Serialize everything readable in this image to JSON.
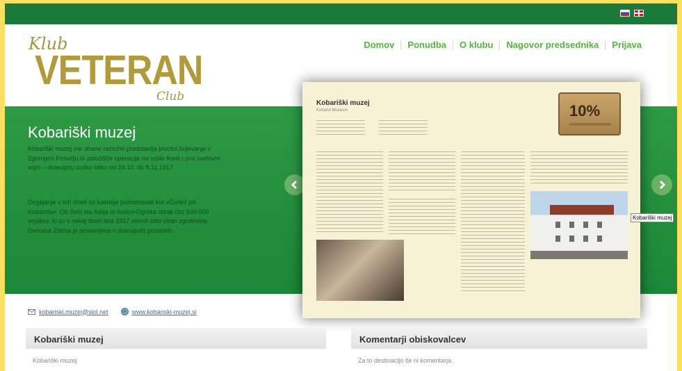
{
  "header": {
    "flags": [
      "slovenian-flag-icon",
      "english-flag-icon"
    ]
  },
  "logo": {
    "top": "Klub",
    "main": "VETERAN",
    "bottom": "Club"
  },
  "nav": {
    "items": [
      "Domov",
      "Ponudba",
      "O klubu",
      "Nagovor predsednika",
      "Prijava"
    ]
  },
  "hero": {
    "title": "Kobariški muzej",
    "paragraph1": "Kobariški muzej me ahane razložel predstavlja prvotni bojevanje v Zgornjem Posočju in zatočišče operacije na soški fronti i prvi svetovni vojni – dvanajstu soško bitko od 24.10. do 8.11.1917.",
    "paragraph2": "Dogajanje v teh dneh so kasneje poimenovali kot »Čudež pri Kobaridu«. Ob Soči sta Italija in Avstro-Ogrska zbrali čez 500 000 vojakov, ki so v nekaj dneh leta 1917 obrnili celo stran zgodovine. Dvorana Zbirna je postavljena v dvanajstih prostorih."
  },
  "card": {
    "title": "Kobariški muzej",
    "subtitle": "Kobarid Museum",
    "badge": "10%"
  },
  "tooltip": "Kobariški muzej",
  "links": {
    "email": "kobariski.muzej@siol.net",
    "web": "www.kobariski-muzej.si"
  },
  "panels": {
    "left": {
      "title": "Kobariški muzej",
      "body": "Kobariški muzej"
    },
    "right": {
      "title": "Komentarji obiskovalcev",
      "body": "Za to destinacijo še ni komentarja."
    }
  },
  "colors": {
    "topbar": "#1b7a3a",
    "band": "#2e9a45",
    "nav": "#55b240",
    "logo": "#b09a3c",
    "frame": "#f9e060"
  }
}
